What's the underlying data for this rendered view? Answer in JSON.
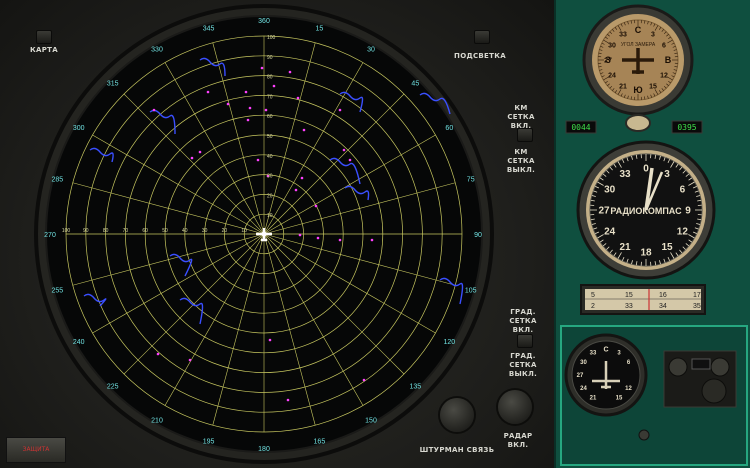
{
  "colors": {
    "grid": "#c8c860",
    "blip": "#ff40ff",
    "terrain": "#3a4fff",
    "cyan_label": "#70e0e0",
    "panel_green": "#0f4f3f"
  },
  "radar": {
    "bearing_labels": [
      "360",
      "15",
      "30",
      "45",
      "60",
      "75",
      "90",
      "105",
      "120",
      "135",
      "150",
      "165",
      "180",
      "195",
      "210",
      "225",
      "240",
      "255",
      "270",
      "285",
      "300",
      "315",
      "330",
      "345"
    ],
    "range_labels": [
      "100",
      "90",
      "80",
      "70",
      "60",
      "50",
      "40",
      "30",
      "20",
      "10"
    ],
    "aircraft_icon": "aircraft-icon"
  },
  "buttons": {
    "map": "КАРТА",
    "backlight": "ПОДСВЕТКА",
    "km_grid_on": "КМ СЕТКА ВКЛ.",
    "km_grid_off": "КМ СЕТКА ВЫКЛ.",
    "deg_grid_on": "ГРАД. СЕТКА ВКЛ.",
    "deg_grid_off": "ГРАД. СЕТКА ВЫКЛ.",
    "navigator_comm": "ШТУРМАН СВЯЗЬ",
    "radar_on": "РАДАР ВКЛ."
  },
  "counters": {
    "left": "0044",
    "right": "0395"
  },
  "compass": {
    "n": "С",
    "e": "В",
    "s": "Ю",
    "w": "З",
    "ticks": [
      "3",
      "6",
      "12",
      "15",
      "21",
      "24",
      "27",
      "30",
      "33"
    ],
    "inner": "УГОЛ ЗАМЕРА"
  },
  "radiocompass": {
    "title": "РАДИОКОМПАС",
    "numbers": [
      "0",
      "3",
      "6",
      "9",
      "12",
      "15",
      "18",
      "21",
      "24",
      "27",
      "30",
      "33"
    ]
  },
  "scale": {
    "top": [
      "5",
      "15",
      "16",
      "17"
    ],
    "bottom": [
      "2",
      "33",
      "34",
      "35"
    ]
  },
  "mini_compass": {
    "n": "С",
    "labels": [
      "3",
      "6",
      "12",
      "15",
      "21",
      "24",
      "27",
      "30",
      "33"
    ]
  },
  "badge": "ЗАЩИТА"
}
